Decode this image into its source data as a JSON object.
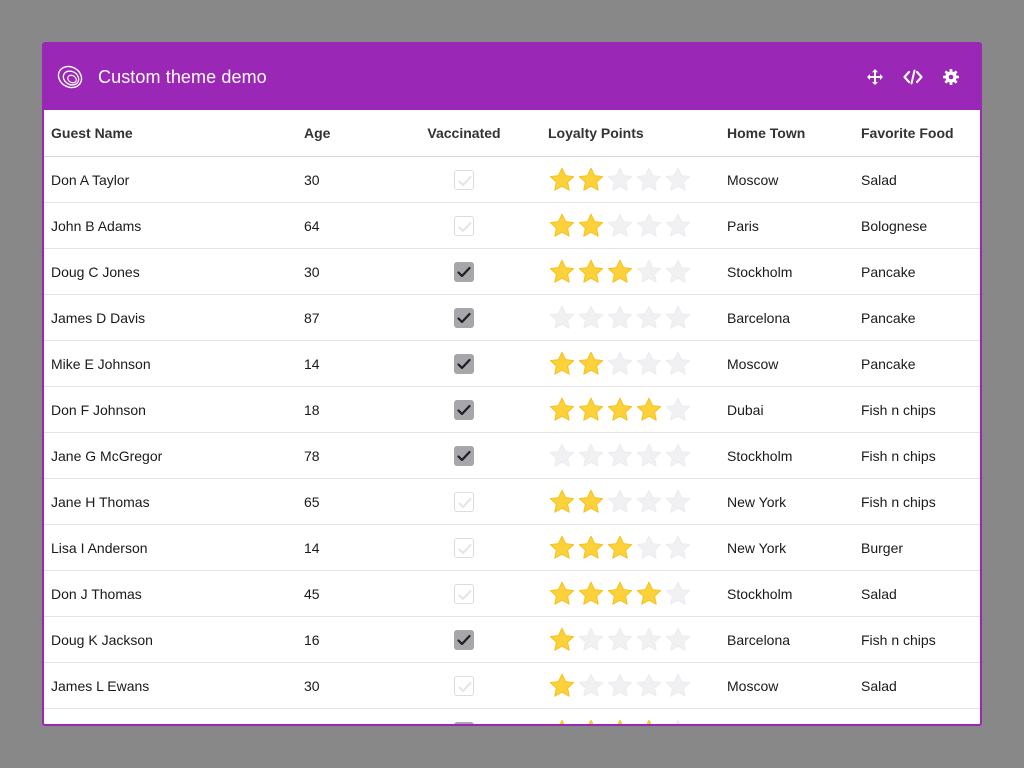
{
  "window": {
    "title": "Custom theme demo",
    "accent_color": "#9b27b6",
    "icons": [
      "logo-icon",
      "move-icon",
      "code-icon",
      "gear-icon"
    ]
  },
  "table": {
    "columns": [
      "Guest Name",
      "Age",
      "Vaccinated",
      "Loyalty Points",
      "Home Town",
      "Favorite Food"
    ],
    "max_stars": 5,
    "rows": [
      {
        "name": "Don A Taylor",
        "age": "30",
        "vaccinated": false,
        "loyalty": 2,
        "town": "Moscow",
        "food": "Salad"
      },
      {
        "name": "John B Adams",
        "age": "64",
        "vaccinated": false,
        "loyalty": 2,
        "town": "Paris",
        "food": "Bolognese"
      },
      {
        "name": "Doug C Jones",
        "age": "30",
        "vaccinated": true,
        "loyalty": 3,
        "town": "Stockholm",
        "food": "Pancake"
      },
      {
        "name": "James D Davis",
        "age": "87",
        "vaccinated": true,
        "loyalty": 0,
        "town": "Barcelona",
        "food": "Pancake"
      },
      {
        "name": "Mike E Johnson",
        "age": "14",
        "vaccinated": true,
        "loyalty": 2,
        "town": "Moscow",
        "food": "Pancake"
      },
      {
        "name": "Don F Johnson",
        "age": "18",
        "vaccinated": true,
        "loyalty": 4,
        "town": "Dubai",
        "food": "Fish n chips"
      },
      {
        "name": "Jane G McGregor",
        "age": "78",
        "vaccinated": true,
        "loyalty": 0,
        "town": "Stockholm",
        "food": "Fish n chips"
      },
      {
        "name": "Jane H Thomas",
        "age": "65",
        "vaccinated": false,
        "loyalty": 2,
        "town": "New York",
        "food": "Fish n chips"
      },
      {
        "name": "Lisa I Anderson",
        "age": "14",
        "vaccinated": false,
        "loyalty": 3,
        "town": "New York",
        "food": "Burger"
      },
      {
        "name": "Don J Thomas",
        "age": "45",
        "vaccinated": false,
        "loyalty": 4,
        "town": "Stockholm",
        "food": "Salad"
      },
      {
        "name": "Doug K Jackson",
        "age": "16",
        "vaccinated": true,
        "loyalty": 1,
        "town": "Barcelona",
        "food": "Fish n chips"
      },
      {
        "name": "James L Ewans",
        "age": "30",
        "vaccinated": false,
        "loyalty": 1,
        "town": "Moscow",
        "food": "Salad"
      },
      {
        "name": "",
        "age": "",
        "vaccinated": true,
        "loyalty": 4,
        "town": "",
        "food": ""
      }
    ]
  }
}
